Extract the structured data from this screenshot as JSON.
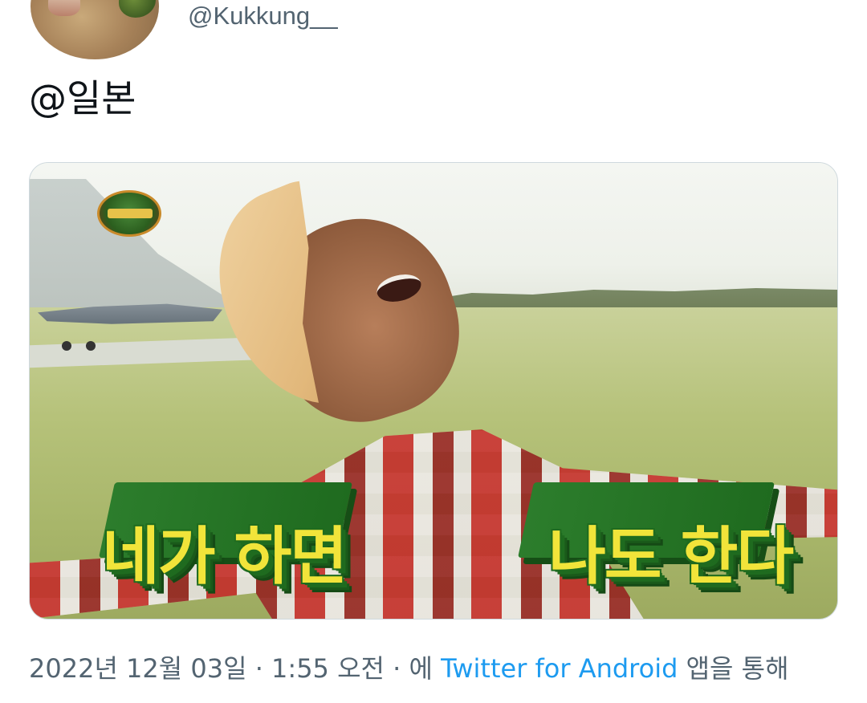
{
  "author": {
    "handle": "@Kukkung__"
  },
  "tweet": {
    "text": "@일본"
  },
  "media": {
    "caption_left": "네가 하면",
    "caption_right": "나도 한다"
  },
  "meta": {
    "timestamp": "2022년 12월 03일 · 1:55 오전 · 에",
    "app_link": "Twitter for Android",
    "suffix": "앱을 통해"
  },
  "colors": {
    "link": "#1d9bf0",
    "secondary_text": "#536471",
    "primary_text": "#0f1419",
    "caption_fill": "#f1e43a",
    "caption_shadow": "#1f6b1f"
  }
}
